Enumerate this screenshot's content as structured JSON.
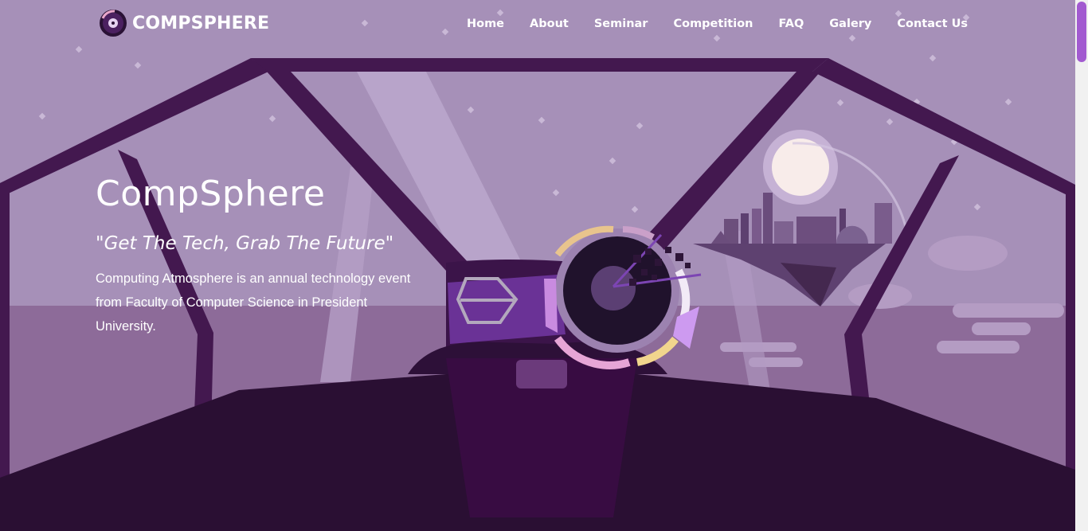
{
  "brand": {
    "name": "COMPSPHERE",
    "logo_icon": "vinyl-disc-icon"
  },
  "nav": {
    "items": [
      {
        "label": "Home"
      },
      {
        "label": "About"
      },
      {
        "label": "Seminar"
      },
      {
        "label": "Competition"
      },
      {
        "label": "FAQ"
      },
      {
        "label": "Galery"
      },
      {
        "label": "Contact Us"
      }
    ]
  },
  "hero": {
    "title": "CompSphere",
    "tagline": "\"Get The Tech, Grab The Future\"",
    "description": "Computing Atmosphere is an annual technology event from Faculty of Computer Science in President University."
  },
  "colors": {
    "sky": "#a78fb8",
    "frame": "#43184f",
    "dashboard": "#2a0f33",
    "accent": "#a25ad0"
  }
}
